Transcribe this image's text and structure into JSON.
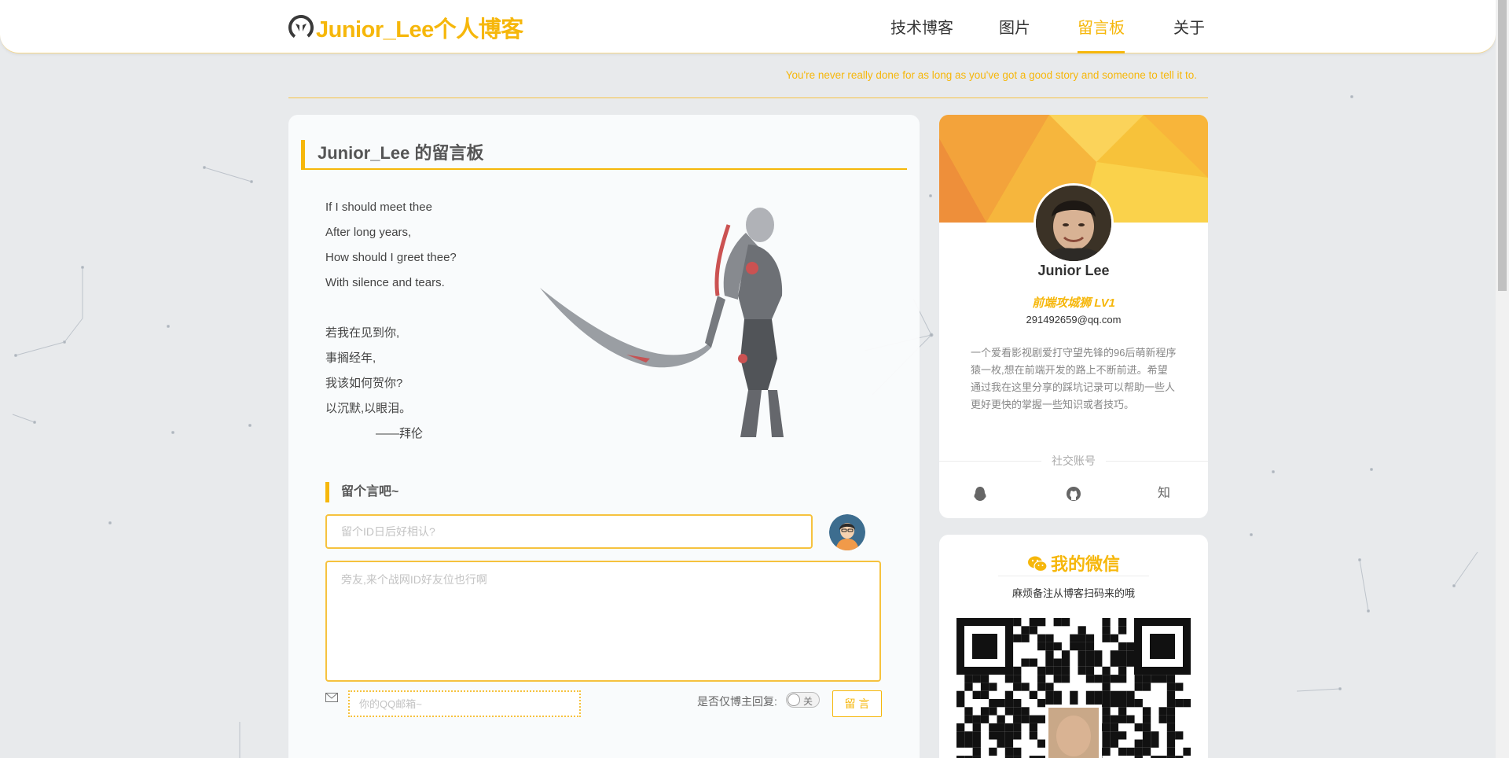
{
  "header": {
    "brand": "Junior_Lee个人博客",
    "nav": [
      {
        "label": "技术博客"
      },
      {
        "label": "图片"
      },
      {
        "label": "留言板",
        "active": true
      },
      {
        "label": "关于"
      }
    ]
  },
  "motto": "You're never really done for as long as you've got a good story and someone to tell it to.",
  "board": {
    "title": "Junior_Lee 的留言板",
    "poem_en": [
      "If I should meet thee",
      "After long years,",
      "How should I greet thee?",
      "With silence and tears."
    ],
    "poem_cn": [
      "若我在见到你,",
      "事搁经年,",
      "我该如何贺你?",
      "以沉默,以眼泪。"
    ],
    "author": "——拜伦"
  },
  "form": {
    "title": "留个言吧~",
    "id_placeholder": "留个ID日后好相认?",
    "message_placeholder": "旁友,来个战网ID好友位也行啊",
    "email_placeholder": "你的QQ邮箱~",
    "reply_label": "是否仅博主回复:",
    "toggle_label": "关",
    "toggle_on": false,
    "submit_label": "留 言"
  },
  "profile": {
    "name": "Junior Lee",
    "level": "前端攻城狮 LV1",
    "email": "291492659@qq.com",
    "description": "一个爱看影视剧爱打守望先锋的96后萌新程序猿一枚,想在前端开发的路上不断前进。希望通过我在这里分享的踩坑记录可以帮助一些人更好更快的掌握一些知识或者技巧。",
    "social_title": "社交账号",
    "social": [
      {
        "icon": "qq-icon"
      },
      {
        "icon": "github-icon"
      },
      {
        "icon": "zhihu-icon",
        "text": "知"
      }
    ]
  },
  "wechat": {
    "title": "我的微信",
    "note": "麻烦备注从博客扫码来的哦"
  },
  "colors": {
    "accent": "#f6b70b",
    "background": "#e8eaec"
  }
}
